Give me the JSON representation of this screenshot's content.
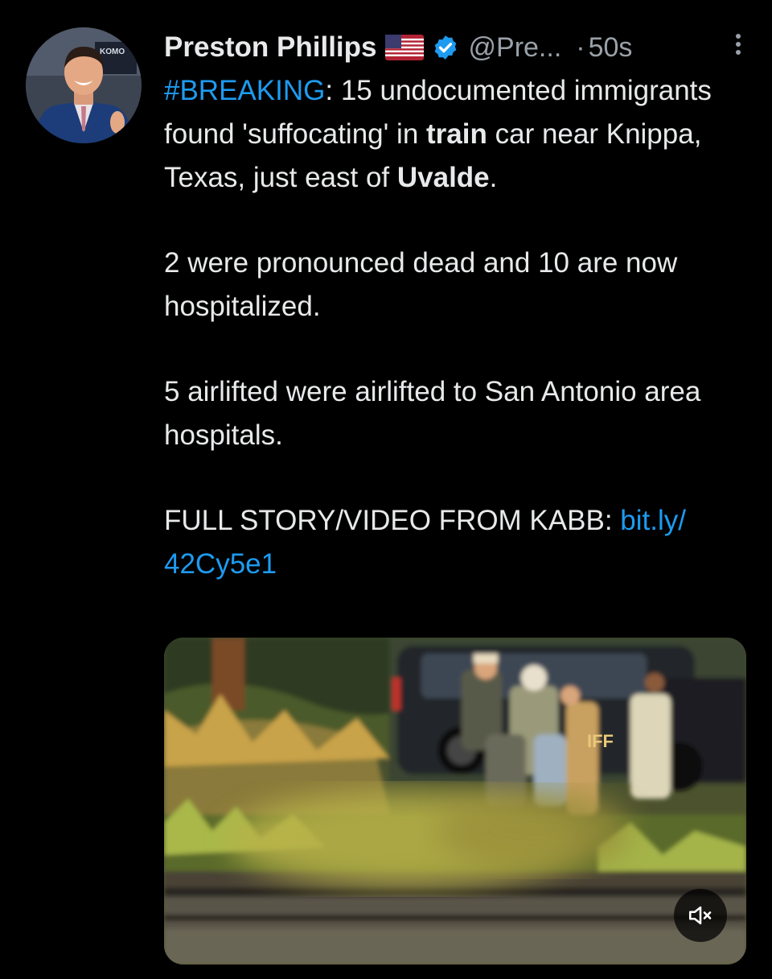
{
  "tweet": {
    "author_name": "Preston Phillips",
    "handle": "@Pre...",
    "separator": "·",
    "timestamp": "50s",
    "hashtag": "#BREAKING",
    "p1_colon": ":",
    "p1_text_a": "  15 undocumented immigrants found 'suffocating' in ",
    "p1_bold_a": "train",
    "p1_text_b": " car near Knippa, Texas, just east of ",
    "p1_bold_b": "Uvalde",
    "p1_text_c": ".",
    "p2": "2 were pronounced dead and 10 are now hospitalized.",
    "p3": "5 airlifted were airlifted to San Antonio area hospitals.",
    "p4_text": "FULL STORY/VIDEO FROM KABB: ",
    "p4_link": "bit.ly/ 42Cy5e1",
    "avatar_badge_text": "KOMO",
    "video_vehicle_text": "IFF"
  },
  "icons": {
    "flag": "us-flag-icon",
    "verified": "verified-badge-icon",
    "more": "more-vertical-icon",
    "mute": "speaker-muted-icon"
  },
  "colors": {
    "background": "#000000",
    "text": "#e7e9ea",
    "secondary_text": "#9aa1a8",
    "link": "#1d9bf0",
    "verified": "#1d9bf0"
  }
}
